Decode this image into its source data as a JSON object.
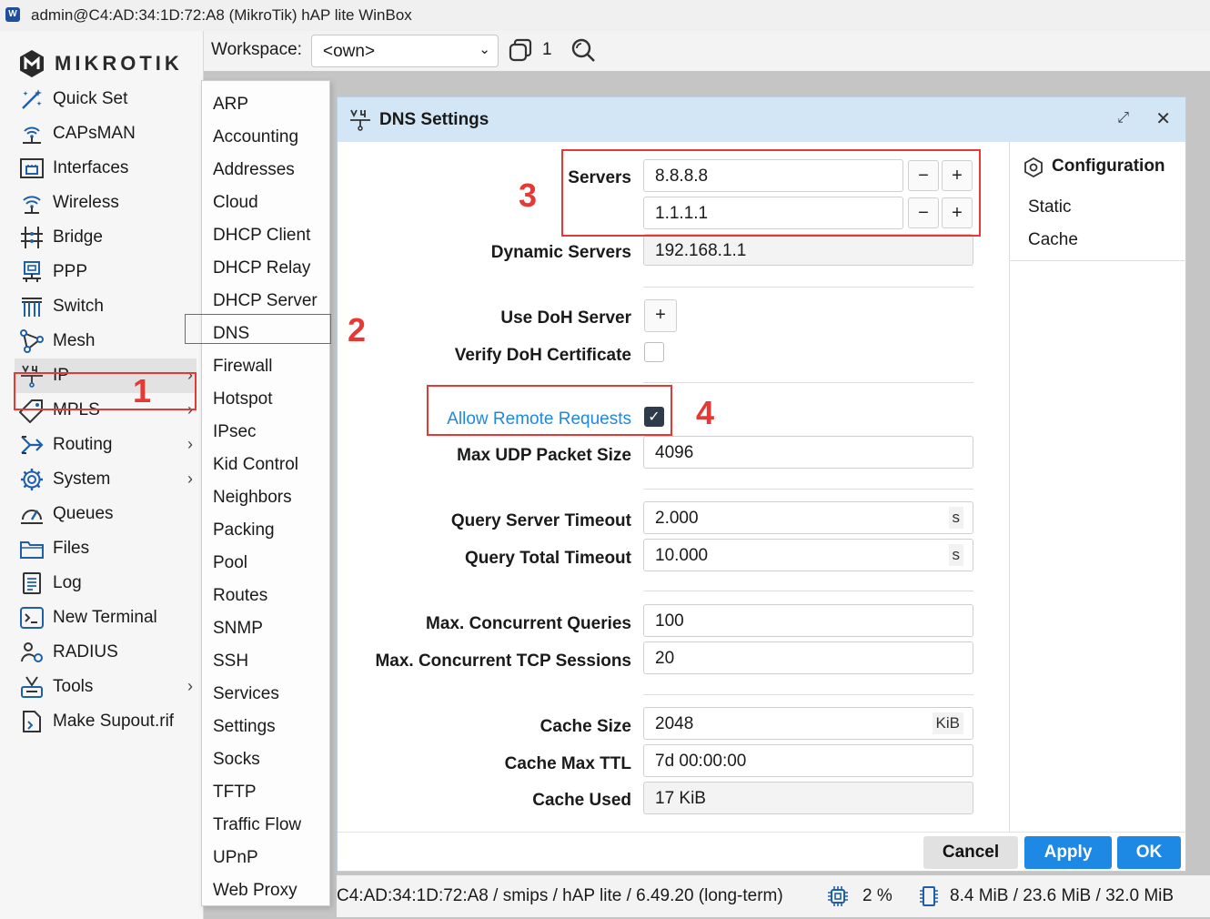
{
  "window": {
    "title": "admin@C4:AD:34:1D:72:A8 (MikroTik) hAP lite WinBox",
    "app_icon": "W"
  },
  "logo": {
    "text": "MIKROTIK"
  },
  "sidebar": {
    "items": [
      {
        "label": "Quick Set",
        "icon": "quick-set-icon"
      },
      {
        "label": "CAPsMAN",
        "icon": "capsman-icon"
      },
      {
        "label": "Interfaces",
        "icon": "interfaces-icon"
      },
      {
        "label": "Wireless",
        "icon": "wireless-icon"
      },
      {
        "label": "Bridge",
        "icon": "bridge-icon"
      },
      {
        "label": "PPP",
        "icon": "ppp-icon"
      },
      {
        "label": "Switch",
        "icon": "switch-icon"
      },
      {
        "label": "Mesh",
        "icon": "mesh-icon"
      },
      {
        "label": "IP",
        "icon": "ip-icon",
        "has_submenu": true,
        "active": true
      },
      {
        "label": "MPLS",
        "icon": "mpls-icon",
        "has_submenu": true
      },
      {
        "label": "Routing",
        "icon": "routing-icon",
        "has_submenu": true
      },
      {
        "label": "System",
        "icon": "system-icon",
        "has_submenu": true
      },
      {
        "label": "Queues",
        "icon": "queues-icon"
      },
      {
        "label": "Files",
        "icon": "files-icon"
      },
      {
        "label": "Log",
        "icon": "log-icon"
      },
      {
        "label": "New Terminal",
        "icon": "terminal-icon"
      },
      {
        "label": "RADIUS",
        "icon": "radius-icon"
      },
      {
        "label": "Tools",
        "icon": "tools-icon",
        "has_submenu": true
      },
      {
        "label": "Make Supout.rif",
        "icon": "supout-icon"
      }
    ]
  },
  "toolbar": {
    "workspace_label": "Workspace:",
    "workspace_value": "<own>",
    "window_count": "1"
  },
  "submenu": {
    "items": [
      "ARP",
      "Accounting",
      "Addresses",
      "Cloud",
      "DHCP Client",
      "DHCP Relay",
      "DHCP Server",
      "DNS",
      "Firewall",
      "Hotspot",
      "IPsec",
      "Kid Control",
      "Neighbors",
      "Packing",
      "Pool",
      "Routes",
      "SNMP",
      "SSH",
      "Services",
      "Settings",
      "Socks",
      "TFTP",
      "Traffic Flow",
      "UPnP",
      "Web Proxy"
    ],
    "selected": "DNS"
  },
  "dialog": {
    "title": "DNS Settings",
    "servers_label": "Servers",
    "servers": [
      "8.8.8.8",
      "1.1.1.1"
    ],
    "dynamic_servers_label": "Dynamic Servers",
    "dynamic_servers": "192.168.1.1",
    "use_doh_label": "Use DoH Server",
    "verify_doh_label": "Verify DoH Certificate",
    "verify_doh_checked": false,
    "allow_remote_label": "Allow Remote Requests",
    "allow_remote_checked": true,
    "max_udp_label": "Max UDP Packet Size",
    "max_udp": "4096",
    "query_server_timeout_label": "Query Server Timeout",
    "query_server_timeout": "2.000",
    "query_total_timeout_label": "Query Total Timeout",
    "query_total_timeout": "10.000",
    "seconds_unit": "s",
    "max_concurrent_queries_label": "Max. Concurrent Queries",
    "max_concurrent_queries": "100",
    "max_concurrent_tcp_label": "Max. Concurrent TCP Sessions",
    "max_concurrent_tcp": "20",
    "cache_size_label": "Cache Size",
    "cache_size": "2048",
    "cache_size_unit": "KiB",
    "cache_max_ttl_label": "Cache Max TTL",
    "cache_max_ttl": "7d 00:00:00",
    "cache_used_label": "Cache Used",
    "cache_used": "17 KiB",
    "side": {
      "header": "Configuration",
      "tabs": [
        "Static",
        "Cache"
      ]
    },
    "buttons": {
      "cancel": "Cancel",
      "apply": "Apply",
      "ok": "OK"
    }
  },
  "statusbar": {
    "device": "C4:AD:34:1D:72:A8 / smips / hAP lite / 6.49.20 (long-term)",
    "cpu": "2 %",
    "memory": "8.4 MiB / 23.6 MiB / 32.0 MiB"
  },
  "annotations": [
    "1",
    "2",
    "3",
    "4"
  ],
  "colors": {
    "annotation": "#e53935",
    "accent": "#1e88e5",
    "title_bar": "#d3e6f6"
  }
}
